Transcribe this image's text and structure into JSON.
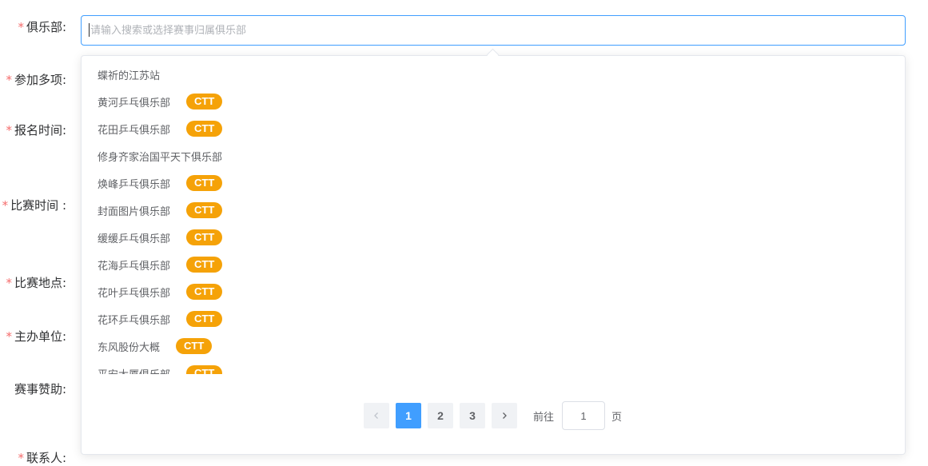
{
  "form": {
    "labels": [
      {
        "text": "俱乐部:",
        "required": true
      },
      {
        "text": "参加多项:",
        "required": true
      },
      {
        "text": "报名时间:",
        "required": true
      },
      {
        "text": "比赛时间 :",
        "required": true
      },
      {
        "text": "比赛地点:",
        "required": true
      },
      {
        "text": "主办单位:",
        "required": true
      },
      {
        "text": "赛事赞助:",
        "required": false
      },
      {
        "text": "联系人:",
        "required": true
      }
    ],
    "required_mark": "*"
  },
  "club_select": {
    "value": "",
    "placeholder": "请输入搜索或选择赛事归属俱乐部"
  },
  "dropdown": {
    "options": [
      {
        "name": "蝶祈的江苏站",
        "badge": ""
      },
      {
        "name": "黄河乒乓俱乐部",
        "badge": "CTT"
      },
      {
        "name": "花田乒乓俱乐部",
        "badge": "CTT"
      },
      {
        "name": "修身齐家治国平天下俱乐部",
        "badge": ""
      },
      {
        "name": "焕峰乒乓俱乐部",
        "badge": "CTT"
      },
      {
        "name": "封面图片俱乐部",
        "badge": "CTT"
      },
      {
        "name": "缓缓乒乓俱乐部",
        "badge": "CTT"
      },
      {
        "name": "花海乒乓俱乐部",
        "badge": "CTT"
      },
      {
        "name": "花叶乒乓俱乐部",
        "badge": "CTT"
      },
      {
        "name": "花环乒乓俱乐部",
        "badge": "CTT"
      },
      {
        "name": "东风股份大概",
        "badge": "CTT"
      },
      {
        "name": "平安大厦俱乐部",
        "badge": "CTT"
      }
    ]
  },
  "pagination": {
    "prev_icon": "chevron-left-icon",
    "next_icon": "chevron-right-icon",
    "pages": [
      "1",
      "2",
      "3"
    ],
    "current_page": "1",
    "goto_label": "前往",
    "goto_value": "1",
    "page_suffix": "页"
  },
  "colors": {
    "primary": "#409eff",
    "badge": "#f5a208",
    "required": "#f56c6c"
  }
}
